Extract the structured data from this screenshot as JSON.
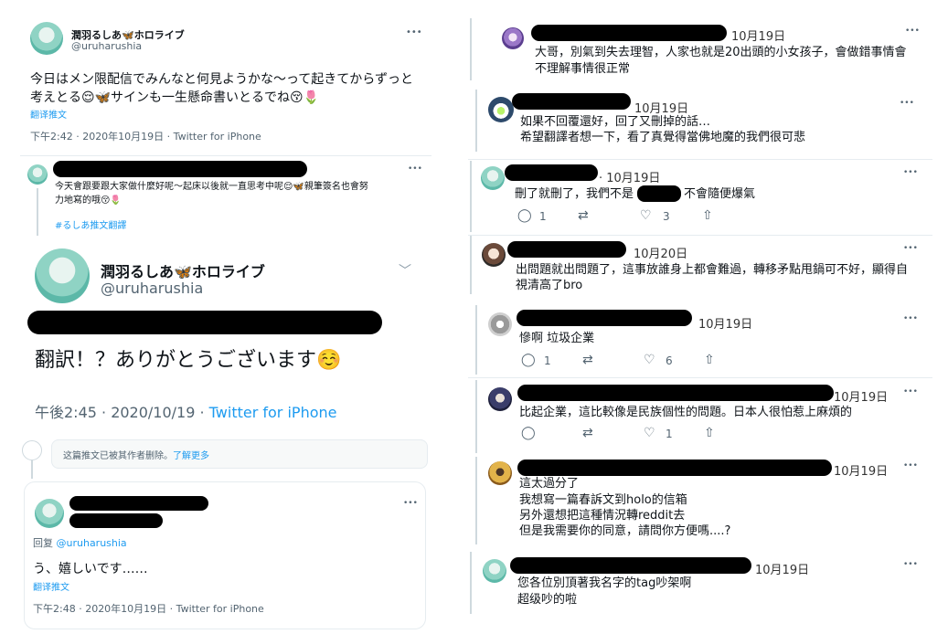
{
  "left": {
    "top_tweet": {
      "display_name": "潤羽るしあ🦋ホロライブ",
      "handle": "@uruharushia",
      "text_line1": "今日はメン限配信でみんなと何見ようかな～って起きてからずっと",
      "text_line2": "考えとる😌🦋サインも一生懸命書いとるでね😚🌷",
      "translate": "翻译推文",
      "meta": "下午2:42 · 2020年10月19日 · Twitter for iPhone",
      "more": "•••"
    },
    "translation_tweet": {
      "text_line1": "今天會跟要跟大家做什麼好呢～起床以後就一直思考中呢😌🦋親筆簽名也會努",
      "text_line2": "力地寫的哦😚🌷",
      "hashtag": "#るしあ推文翻譯",
      "more": "•••"
    },
    "reply_big": {
      "display_name": "潤羽るしあ🦋ホロライブ",
      "handle": "@uruharushia",
      "text": "翻訳！？ありがとうございます☺️",
      "meta_time": "午後2:45 · 2020/10/19 · ",
      "meta_source": "Twitter for iPhone",
      "chevron": "﹀"
    },
    "deleted_notice": {
      "text": "这篇推文已被其作者删除。",
      "link": "了解更多"
    },
    "quote_card": {
      "reply_to_prefix": "回复 ",
      "reply_to_handle": "@uruharushia",
      "text": "う、嬉しいです……",
      "translate": "翻译推文",
      "meta": "下午2:48 · 2020年10月19日 · Twitter for iPhone",
      "more": "•••"
    }
  },
  "right": {
    "comments": [
      {
        "date": "10月19日",
        "lines": [
          "大哥，別氣到失去理智，人家也就是20出頭的小女孩子，會做錯事情會",
          "不理解事情很正常"
        ]
      },
      {
        "date": "10月19日",
        "lines": [
          "如果不回覆還好，回了又刪掉的話…",
          "希望翻譯者想一下，看了真覺得當佛地魔的我們很可悲"
        ]
      },
      {
        "date": "· 10月19日",
        "lines_a": "刪了就刪了，我們不是",
        "lines_b": "不會隨便爆氣",
        "reply": "1",
        "retweet": "",
        "like": "3"
      },
      {
        "date": "10月20日",
        "lines": [
          "出問題就出問題了，這事放誰身上都會難過，轉移矛點甩鍋可不好，顯得自",
          "視清高了bro"
        ]
      },
      {
        "date": "10月19日",
        "lines": [
          "慘啊 垃圾企業"
        ],
        "reply": "1",
        "like": "6"
      },
      {
        "date": "10月19日",
        "lines": [
          "比起企業，這比較像是民族個性的問題。日本人很怕惹上麻煩的"
        ],
        "reply": "",
        "like": "1"
      },
      {
        "date": "10月19日",
        "lines": [
          "這太過分了",
          "我想寫一篇春訴文到holo的信箱",
          "另外還想把這種情況轉reddit去",
          "但是我需要你的同意，請問你方便嗎....?"
        ]
      },
      {
        "date": "10月19日",
        "lines": [
          "您各位別頂著我名字的tag吵架啊",
          "超级吵的啦"
        ]
      }
    ],
    "more": "•••"
  },
  "icons": {
    "reply": "reply-icon",
    "retweet": "retweet-icon",
    "like": "like-icon",
    "share": "share-icon"
  }
}
